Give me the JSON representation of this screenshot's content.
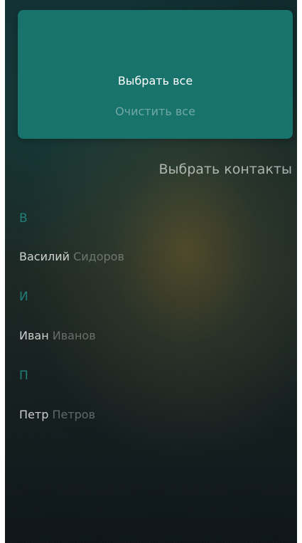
{
  "menu": {
    "select_all": "Выбрать все",
    "clear_all": "Очистить все"
  },
  "header": {
    "title": "Выбрать контакты"
  },
  "sections": [
    {
      "letter": "В",
      "contact": {
        "first_name": "Василий",
        "last_name": "Сидоров"
      }
    },
    {
      "letter": "И",
      "contact": {
        "first_name": "Иван",
        "last_name": "Иванов"
      }
    },
    {
      "letter": "П",
      "contact": {
        "first_name": "Петр",
        "last_name": "Петров"
      }
    }
  ],
  "colors": {
    "accent": "#17736b",
    "section_letter": "#1f7f78"
  }
}
